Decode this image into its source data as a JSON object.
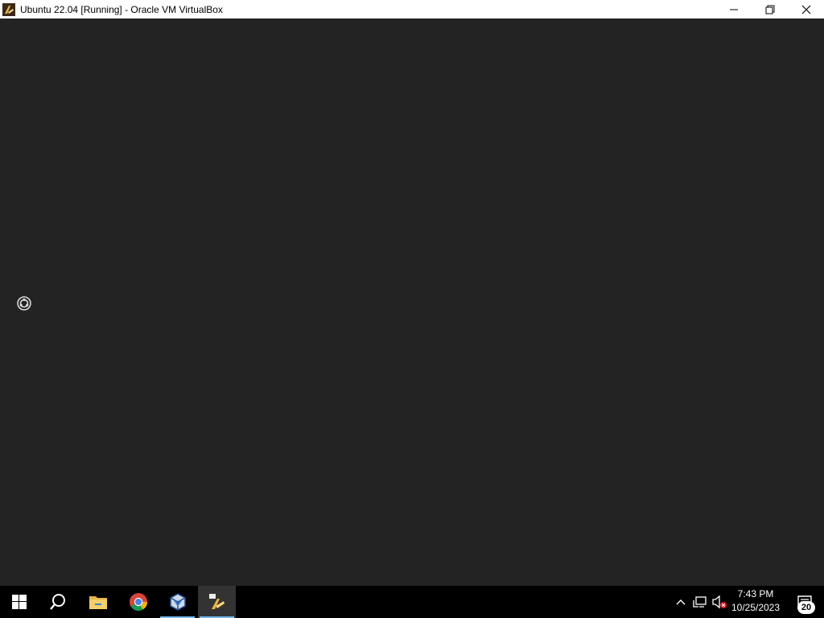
{
  "window": {
    "title": "Ubuntu 22.04 [Running] - Oracle VM VirtualBox",
    "controls": [
      "minimize-icon",
      "restore-icon",
      "close-icon"
    ]
  },
  "vm": {
    "state": "booting",
    "indicator_icon": "loading-spinner-icon"
  },
  "taskbar": {
    "apps": [
      {
        "name": "start",
        "icon": "windows-logo-icon"
      },
      {
        "name": "search",
        "icon": "search-icon"
      },
      {
        "name": "file-explorer",
        "icon": "folder-icon"
      },
      {
        "name": "chrome",
        "icon": "chrome-icon"
      },
      {
        "name": "virtualbox-manager",
        "icon": "virtualbox-icon",
        "running": true
      },
      {
        "name": "virtualbox-vm",
        "icon": "virtualbox-vm-icon",
        "running": true,
        "active": true
      }
    ],
    "tray": {
      "icons": [
        "chevron-up-icon",
        "network-icon",
        "volume-muted-icon"
      ],
      "time": "7:43 PM",
      "date": "10/25/2023",
      "notification_count": "20"
    }
  },
  "colors": {
    "vm_background": "#232323",
    "taskbar": "#000000",
    "running_indicator": "#76b9ed"
  }
}
